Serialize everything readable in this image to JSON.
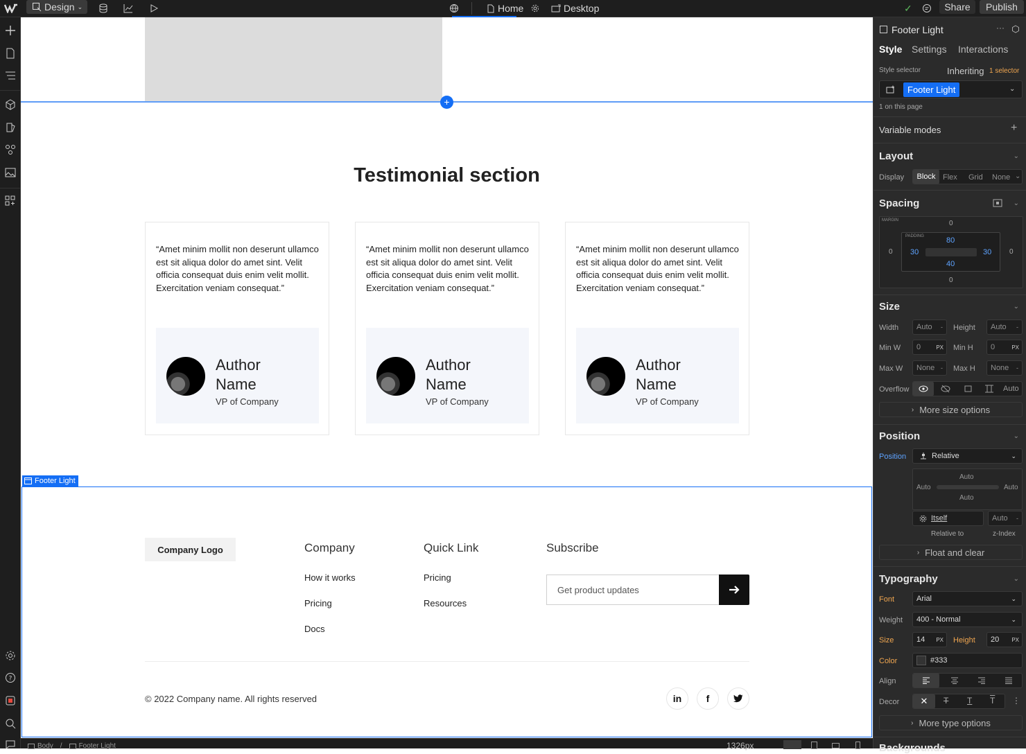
{
  "topbar": {
    "mode_label": "Design",
    "page_label": "Home",
    "breakpoint_label": "Desktop",
    "share_label": "Share",
    "publish_label": "Publish"
  },
  "canvas": {
    "section_title": "Testimonial section",
    "testimonials": [
      {
        "quote": "“Amet minim mollit non deserunt ullamco est sit aliqua dolor do amet sint. Velit officia consequat duis enim velit mollit. Exercitation veniam consequat.”",
        "name": "Author Name",
        "role": "VP of Company"
      },
      {
        "quote": "“Amet minim mollit non deserunt ullamco est sit aliqua dolor do amet sint. Velit officia consequat duis enim velit mollit. Exercitation veniam consequat.”",
        "name": "Author Name",
        "role": "VP of Company"
      },
      {
        "quote": "“Amet minim mollit non deserunt ullamco est sit aliqua dolor do amet sint. Velit officia consequat duis enim velit mollit. Exercitation veniam consequat.”",
        "name": "Author Name",
        "role": "VP of Company"
      }
    ],
    "selected_label": "Footer Light",
    "footer": {
      "logo": "Company Logo",
      "company_heading": "Company",
      "company_links": [
        "How it works",
        "Pricing",
        "Docs"
      ],
      "quick_heading": "Quick Link",
      "quick_links": [
        "Pricing",
        "Resources"
      ],
      "subscribe_heading": "Subscribe",
      "subscribe_placeholder": "Get product updates",
      "copyright": "© 2022 Company name. All rights reserved",
      "social": [
        "in",
        "f",
        "t"
      ]
    }
  },
  "statusbar": {
    "crumbs": [
      "Body",
      "Footer Light"
    ],
    "width_readout": "1326px"
  },
  "panel": {
    "element_title": "Footer Light",
    "tabs": [
      "Style",
      "Settings",
      "Interactions"
    ],
    "style_selector_label": "Style selector",
    "inheriting_label": "Inheriting",
    "inheriting_count": "1 selector",
    "class_chip": "Footer Light",
    "on_page": "1 on this page",
    "variable_modes": "Variable modes",
    "layout": {
      "title": "Layout",
      "display_label": "Display",
      "options": [
        "Block",
        "Flex",
        "Grid",
        "None"
      ],
      "active": "Block"
    },
    "spacing": {
      "title": "Spacing",
      "margin_label": "MARGIN",
      "padding_label": "PADDING",
      "margin": {
        "top": "0",
        "right": "0",
        "bottom": "0",
        "left": "0"
      },
      "padding": {
        "top": "80",
        "right": "30",
        "bottom": "40",
        "left": "30"
      }
    },
    "size": {
      "title": "Size",
      "width_label": "Width",
      "width": "Auto",
      "height_label": "Height",
      "height": "Auto",
      "minw_label": "Min W",
      "minw": "0",
      "minw_unit": "PX",
      "minh_label": "Min H",
      "minh": "0",
      "minh_unit": "PX",
      "maxw_label": "Max W",
      "maxw": "None",
      "maxh_label": "Max H",
      "maxh": "None",
      "overflow_label": "Overflow",
      "overflow_auto": "Auto",
      "more": "More size options"
    },
    "position": {
      "title": "Position",
      "label": "Position",
      "value": "Relative",
      "offset_top": "Auto",
      "offset_left": "Auto",
      "offset_right": "Auto",
      "offset_bottom": "Auto",
      "relative_value": "Itself",
      "zindex_value": "Auto",
      "relative_label": "Relative to",
      "zindex_label": "z-Index",
      "float_clear": "Float and clear"
    },
    "typography": {
      "title": "Typography",
      "font_label": "Font",
      "font": "Arial",
      "weight_label": "Weight",
      "weight": "400 - Normal",
      "size_label": "Size",
      "size": "14",
      "size_unit": "PX",
      "height_label": "Height",
      "line_height": "20",
      "line_height_unit": "PX",
      "color_label": "Color",
      "color": "#333",
      "align_label": "Align",
      "decor_label": "Decor",
      "more": "More type options"
    },
    "backgrounds_title": "Backgrounds"
  },
  "colors": {
    "accent": "#146ef5",
    "publish": "#3a3a3a",
    "orange": "#f0a650"
  }
}
